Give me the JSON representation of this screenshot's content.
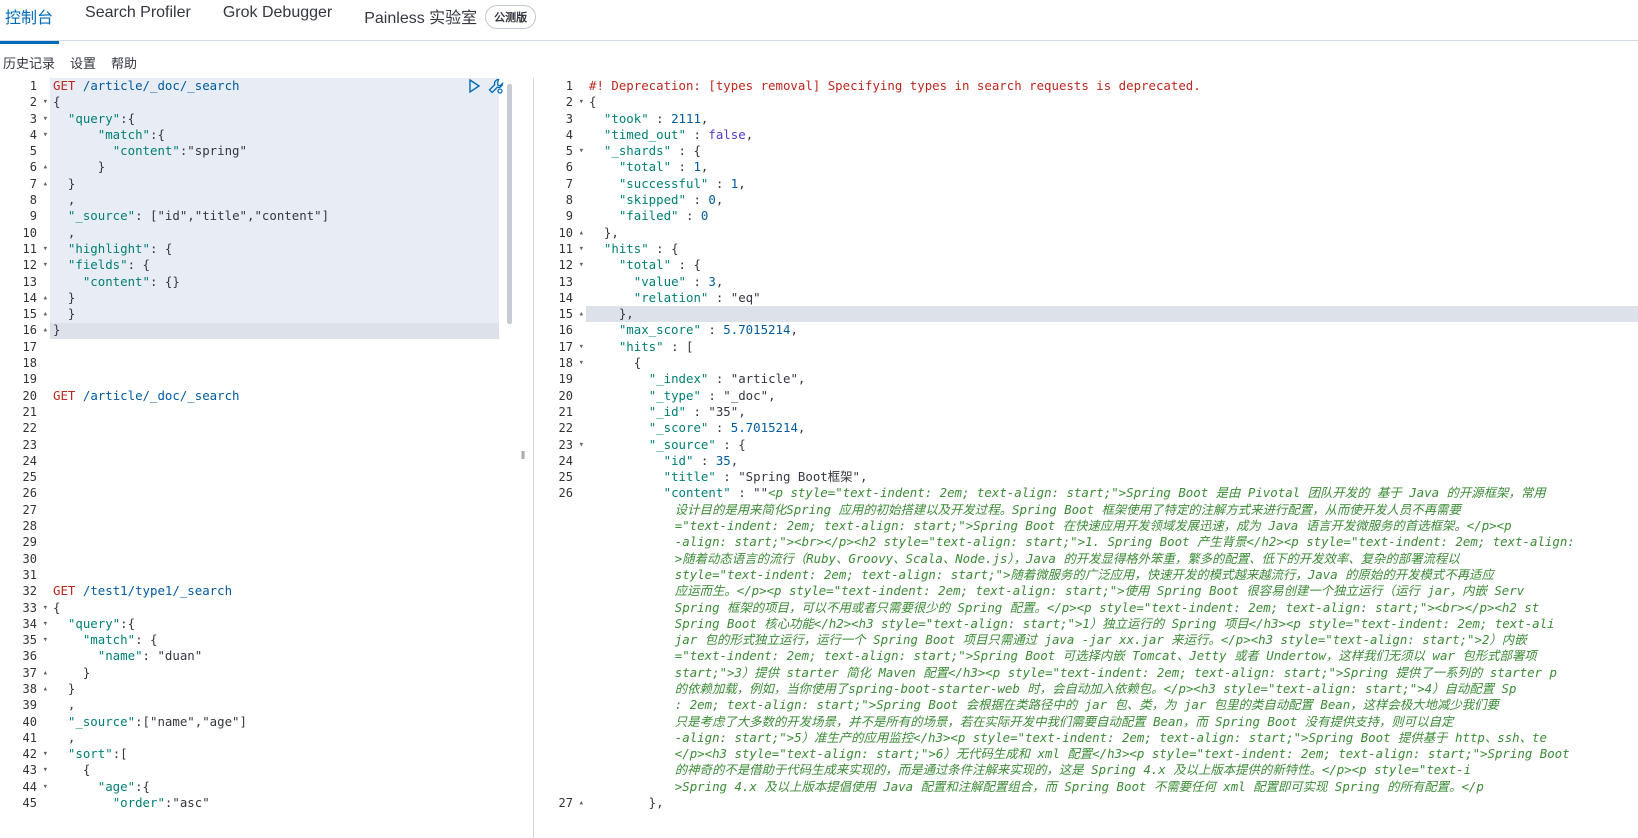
{
  "tabs": [
    {
      "label": "控制台"
    },
    {
      "label": "Search Profiler"
    },
    {
      "label": "Grok Debugger"
    },
    {
      "label": "Painless 实验室"
    }
  ],
  "beta_badge": "公测版",
  "secondary_nav": [
    "历史记录",
    "设置",
    "帮助"
  ],
  "left_editor": {
    "line_numbers": [
      "1",
      "2",
      "3",
      "4",
      "5",
      "6",
      "7",
      "8",
      "9",
      "10",
      "11",
      "12",
      "13",
      "14",
      "15",
      "16",
      "17",
      "18",
      "19",
      "20",
      "21",
      "22",
      "23",
      "24",
      "25",
      "26",
      "27",
      "28",
      "29",
      "30",
      "31",
      "32",
      "33",
      "34",
      "35",
      "36",
      "37",
      "38",
      "39",
      "40",
      "41",
      "42",
      "43",
      "44",
      "45"
    ],
    "lines": [
      "GET /article/_doc/_search",
      "{",
      "  \"query\":{",
      "      \"match\":{",
      "        \"content\":\"spring\"",
      "      }",
      "  }",
      "  ,",
      "  \"_source\": [\"id\",\"title\",\"content\"]",
      "  ,",
      "  \"highlight\": {",
      "  \"fields\": {",
      "    \"content\": {}",
      "  }",
      "  }",
      "}",
      "",
      "",
      "",
      "GET /article/_doc/_search",
      "",
      "",
      "",
      "",
      "",
      "",
      "",
      "",
      "",
      "",
      "",
      "GET /test1/type1/_search",
      "{",
      "  \"query\":{",
      "    \"match\": {",
      "      \"name\": \"duan\"",
      "    }",
      "  }",
      "  ,",
      "  \"_source\":[\"name\",\"age\"]",
      "  ,",
      "  \"sort\":[",
      "    {",
      "      \"age\":{",
      "        \"order\":\"asc\""
    ]
  },
  "right_editor": {
    "line_numbers": [
      "1",
      "2",
      "3",
      "4",
      "5",
      "6",
      "7",
      "8",
      "9",
      "10",
      "11",
      "12",
      "13",
      "14",
      "15",
      "16",
      "17",
      "18",
      "19",
      "20",
      "21",
      "22",
      "23",
      "24",
      "25",
      "26",
      "",
      "",
      "",
      "",
      "",
      "",
      "",
      "",
      "",
      "",
      "",
      "",
      "",
      "",
      "",
      "",
      "",
      "",
      "27"
    ],
    "lines": [
      "#! Deprecation: [types removal] Specifying types in search requests is deprecated.",
      "{",
      "  \"took\" : 2111,",
      "  \"timed_out\" : false,",
      "  \"_shards\" : {",
      "    \"total\" : 1,",
      "    \"successful\" : 1,",
      "    \"skipped\" : 0,",
      "    \"failed\" : 0",
      "  },",
      "  \"hits\" : {",
      "    \"total\" : {",
      "      \"value\" : 3,",
      "      \"relation\" : \"eq\"",
      "    },",
      "    \"max_score\" : 5.7015214,",
      "    \"hits\" : [",
      "      {",
      "        \"_index\" : \"article\",",
      "        \"_type\" : \"_doc\",",
      "        \"_id\" : \"35\",",
      "        \"_score\" : 5.7015214,",
      "        \"_source\" : {",
      "          \"id\" : 35,",
      "          \"title\" : \"Spring Boot框架\","
    ],
    "content_key": "          \"content\" : \"\"\"",
    "content_lines": [
      "<p style=\"text-indent: 2em; text-align: start;\">Spring Boot 是由 Pivotal 团队开发的 基于 Java 的开源框架，常用",
      "设计目的是用来简化Spring 应用的初始搭建以及开发过程。Spring Boot 框架使用了特定的注解方式来进行配置，从而使开发人员不再需要",
      "=\"text-indent: 2em; text-align: start;\">Spring Boot 在快速应用开发领域发展迅速，成为 Java 语言开发微服务的首选框架。</p><p",
      "-align: start;\"><br></p><h2 style=\"text-align: start;\">1. Spring Boot 产生背景</h2><p style=\"text-indent: 2em; text-align:",
      ">随着动态语言的流行（Ruby、Groovy、Scala、Node.js），Java 的开发显得格外笨重，繁多的配置、低下的开发效率、复杂的部署流程以",
      "style=\"text-indent: 2em; text-align: start;\">随着微服务的广泛应用，快速开发的模式越来越流行，Java 的原始的开发模式不再适应",
      "应运而生。</p><p style=\"text-indent: 2em; text-align: start;\">使用 Spring Boot 很容易创建一个独立运行（运行 jar，内嵌 Serv",
      "Spring 框架的项目，可以不用或者只需要很少的 Spring 配置。</p><p style=\"text-indent: 2em; text-align: start;\"><br></p><h2 st",
      "Spring Boot 核心功能</h2><h3 style=\"text-align: start;\">1）独立运行的 Spring 项目</h3><p style=\"text-indent: 2em; text-ali",
      "jar 包的形式独立运行，运行一个 Spring Boot 项目只需通过 java -jar xx.jar 来运行。</p><h3 style=\"text-align: start;\">2）内嵌",
      "=\"text-indent: 2em; text-align: start;\">Spring Boot 可选择内嵌 Tomcat、Jetty 或者 Undertow，这样我们无须以 war 包形式部署项",
      "start;\">3）提供 starter 简化 Maven 配置</h3><p style=\"text-indent: 2em; text-align: start;\">Spring 提供了一系列的 starter p",
      "的依赖加载，例如，当你使用了spring-boot-starter-web 时，会自动加入依赖包。</p><h3 style=\"text-align: start;\">4）自动配置 Sp",
      ": 2em; text-align: start;\">Spring Boot 会根据在类路径中的 jar 包、类，为 jar 包里的类自动配置 Bean，这样会极大地减少我们要",
      "只是考虑了大多数的开发场景，并不是所有的场景，若在实际开发中我们需要自动配置 Bean，而 Spring Boot 没有提供支持，则可以自定",
      "-align: start;\">5）准生产的应用监控</h3><p style=\"text-indent: 2em; text-align: start;\">Spring Boot 提供基于 http、ssh、te",
      "</p><h3 style=\"text-align: start;\">6）无代码生成和 xml 配置</h3><p style=\"text-indent: 2em; text-align: start;\">Spring Boot",
      "的神奇的不是借助于代码生成来实现的，而是通过条件注解来实现的，这是 Spring 4.x 及以上版本提供的新特性。</p><p style=\"text-i",
      ">Spring 4.x 及以上版本提倡使用 Java 配置和注解配置组合，而 Spring Boot 不需要任何 xml 配置即可实现 Spring 的所有配置。</p"
    ],
    "last_line": "        },"
  }
}
